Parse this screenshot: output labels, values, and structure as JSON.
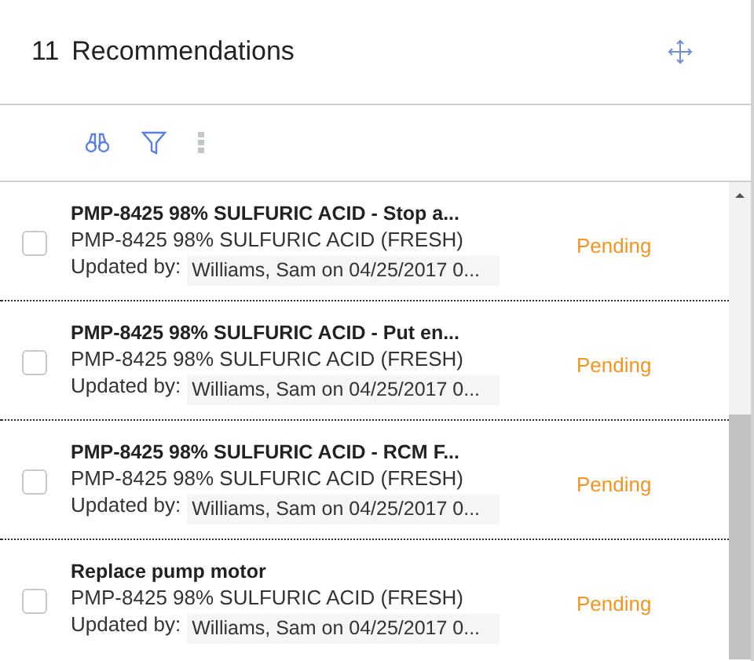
{
  "header": {
    "count": "11",
    "title": "Recommendations"
  },
  "items": [
    {
      "title": "PMP-8425 98% SULFURIC ACID - Stop a...",
      "asset": "PMP-8425 98% SULFURIC ACID (FRESH)",
      "updated_label": "Updated by:",
      "updated_value": "Williams, Sam on 04/25/2017 0...",
      "status": "Pending",
      "checked": false
    },
    {
      "title": "PMP-8425 98% SULFURIC ACID - Put en...",
      "asset": "PMP-8425 98% SULFURIC ACID (FRESH)",
      "updated_label": "Updated by:",
      "updated_value": "Williams, Sam on 04/25/2017 0...",
      "status": "Pending",
      "checked": false
    },
    {
      "title": "PMP-8425 98% SULFURIC ACID - RCM F...",
      "asset": "PMP-8425 98% SULFURIC ACID (FRESH)",
      "updated_label": "Updated by:",
      "updated_value": "Williams, Sam on 04/25/2017 0...",
      "status": "Pending",
      "checked": false
    },
    {
      "title": "Replace pump motor",
      "asset": "PMP-8425 98% SULFURIC ACID (FRESH)",
      "updated_label": "Updated by:",
      "updated_value": "Williams, Sam on 04/25/2017 0...",
      "status": "Pending",
      "checked": false
    }
  ]
}
